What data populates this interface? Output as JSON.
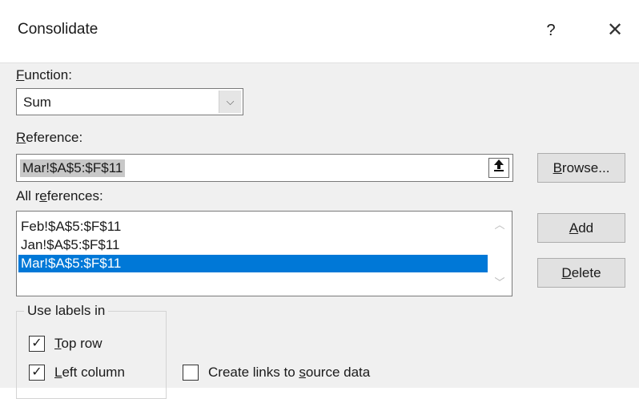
{
  "window": {
    "title": "Consolidate",
    "help_label": "?",
    "close_label": "✕"
  },
  "function": {
    "label_mnemonic": "F",
    "label_rest": "unction:",
    "selected": "Sum",
    "arrow": "⌵"
  },
  "reference": {
    "label_mnemonic": "R",
    "label_rest": "eference:",
    "value": "Mar!$A$5:$F$11",
    "collapse_glyph": "🠕"
  },
  "buttons": {
    "browse_mnemonic": "B",
    "browse_rest": "rowse...",
    "add_mnemonic": "A",
    "add_rest": "dd",
    "delete_mnemonic": "D",
    "delete_rest": "elete"
  },
  "all_references": {
    "label_pre": "All r",
    "label_mnemonic": "e",
    "label_post": "ferences:",
    "items": [
      {
        "text": "Feb!$A$5:$F$11",
        "selected": false
      },
      {
        "text": "Jan!$A$5:$F$11",
        "selected": false
      },
      {
        "text": "Mar!$A$5:$F$11",
        "selected": true
      }
    ],
    "scroll_up": "︿",
    "scroll_down": "﹀"
  },
  "use_labels": {
    "title": "Use labels in",
    "top_row": {
      "mnemonic": "T",
      "rest": "op row",
      "checked": true,
      "mark": "✓"
    },
    "left_column": {
      "mnemonic": "L",
      "rest": "eft column",
      "checked": true,
      "mark": "✓"
    }
  },
  "create_links": {
    "pre": "Create links to ",
    "mnemonic": "s",
    "post": "ource data",
    "checked": false
  }
}
